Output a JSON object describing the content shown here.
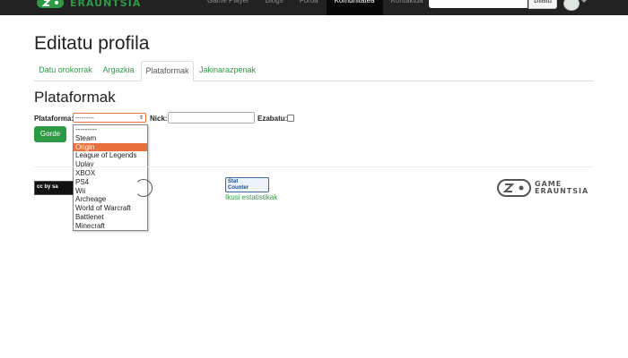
{
  "navbar": {
    "brand_text": "ERAUNTSIA",
    "links": [
      "Game Player",
      "Blogs",
      "Foroa",
      "Komunitatea",
      "Kontaktua"
    ],
    "active_link_index": 3,
    "search_button": "Bilatu"
  },
  "page": {
    "title": "Editatu profila",
    "tabs": [
      "Datu orokorrak",
      "Argazkia",
      "Plataformak",
      "Jakinarazpenak"
    ],
    "active_tab_index": 2,
    "section_title": "Plataformak"
  },
  "form": {
    "platform_label": "Plataforma:",
    "platform_value": "---------",
    "nick_label": "Nick:",
    "nick_value": "",
    "delete_label": "Ezabatu:",
    "delete_checked": false,
    "save_label": "Gorde",
    "platform_options": [
      "---------",
      "Steam",
      "Origin",
      "League of Legends",
      "Uplay",
      "XBOX",
      "PS4",
      "Wii",
      "Archeage",
      "World of Warcraft",
      "Battlenet",
      "Minecraft"
    ],
    "highlighted_option": "Origin"
  },
  "footer": {
    "stats_link": "Ikusi estatistikak",
    "statcounter_line1": "Stat",
    "statcounter_line2": "Counter",
    "logo_line1": "GAME",
    "logo_line2": "ERAUNTSIA",
    "cc_text": "cc by sa"
  },
  "colors": {
    "brand_green": "#2e9a45",
    "navbar_bg": "#222222",
    "highlight_orange": "#e8703a"
  }
}
